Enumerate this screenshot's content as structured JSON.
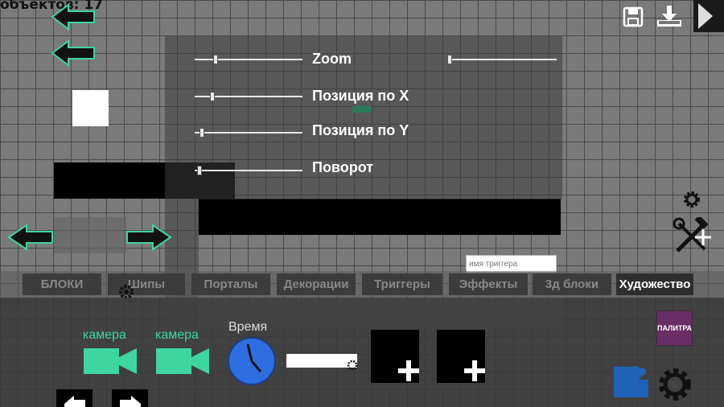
{
  "header": {
    "counter_text": "объектов: 17"
  },
  "sliders": [
    {
      "label": "Zoom",
      "value": 0.18
    },
    {
      "label": "Позиция по X",
      "value": 0.15
    },
    {
      "label": "Позиция по Y",
      "value": 0.05
    },
    {
      "label": "Поворот",
      "value": 0.02
    }
  ],
  "zoom_extra_slider": {
    "value": 0.0
  },
  "trigger_input": {
    "placeholder": "имя триггера"
  },
  "tabs": [
    {
      "label": "БЛОКИ",
      "active": true
    },
    {
      "label": "Шипы",
      "active": false
    },
    {
      "label": "Порталы",
      "active": false
    },
    {
      "label": "Декорации",
      "active": false
    },
    {
      "label": "Триггеры",
      "active": false
    },
    {
      "label": "Эффекты",
      "active": false
    },
    {
      "label": "3д блоки",
      "active": false
    },
    {
      "label": "Художество",
      "active": true
    }
  ],
  "bottom": {
    "camera1_label": "камера",
    "camera2_label": "камера",
    "time_label": "Время",
    "palette_label": "ПАЛИТРА"
  },
  "colors": {
    "accent_green": "#3ed6a0",
    "palette_purple": "#6a2e66",
    "clock_blue": "#2d6fe0"
  },
  "icons": [
    "arrow-left-icon",
    "save-icon",
    "download-icon",
    "play-icon",
    "gear-icon",
    "tools-icon",
    "camera-icon",
    "clock-icon",
    "plus-icon",
    "puzzle-icon"
  ]
}
